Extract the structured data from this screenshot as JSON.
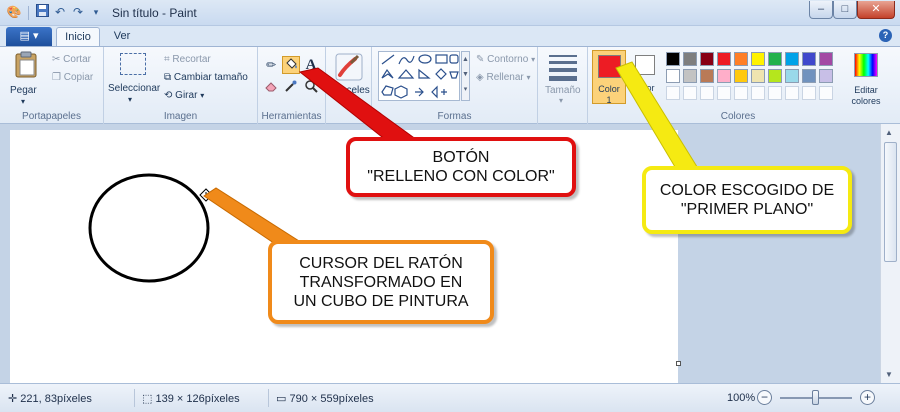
{
  "titlebar": {
    "title": "Sin título - Paint",
    "minimize": "–",
    "maximize": "□",
    "close": "✕",
    "qa_icons": [
      "paint-app-icon",
      "save-icon",
      "undo-icon",
      "redo-icon",
      "customize-qa-icon"
    ]
  },
  "tabs": {
    "app_menu": "▤ ▾",
    "items": [
      "Inicio",
      "Ver"
    ],
    "active": "Inicio",
    "help": "?"
  },
  "ribbon": {
    "portapapeles": {
      "label": "Portapapeles",
      "paste": "Pegar",
      "cut": "Cortar",
      "copy": "Copiar"
    },
    "imagen": {
      "label": "Imagen",
      "select": "Seleccionar",
      "crop": "Recortar",
      "resize": "Cambiar tamaño",
      "rotate": "Girar"
    },
    "herramientas": {
      "label": "Herramientas",
      "text_tool": "A"
    },
    "pinceles": {
      "label": "Pinceles"
    },
    "formas": {
      "label": "Formas",
      "outline": "Contorno",
      "fill": "Rellenar"
    },
    "tamano": {
      "label": "Tamaño"
    },
    "colores": {
      "label": "Colores",
      "color1": "Color 1",
      "color2": "Color",
      "color1_value": "#ed1c24",
      "color2_value": "#ffffff",
      "edit_colors": "Editar colores",
      "palette_row1": [
        "#000000",
        "#7f7f7f",
        "#880015",
        "#ed1c24",
        "#ff7f27",
        "#fff200",
        "#22b14c",
        "#00a2e8",
        "#3f48cc",
        "#a349a4"
      ],
      "palette_row2": [
        "#ffffff",
        "#c3c3c3",
        "#b97a57",
        "#ffaec9",
        "#ffc90e",
        "#efe4b0",
        "#b5e61d",
        "#99d9ea",
        "#7092be",
        "#c8bfe7"
      ]
    }
  },
  "statusbar": {
    "cursor_pos": "221, 83píxeles",
    "selection_size": "139 × 126píxeles",
    "image_size": "790 × 559píxeles",
    "zoom": "100%",
    "zoom_out": "−",
    "zoom_in": "+"
  },
  "callouts": {
    "fill_button": "BOTÓN\n\"RELLENO CON COLOR\"",
    "foreground_color": "COLOR ESCOGIDO DE\n\"PRIMER PLANO\"",
    "cursor": "CURSOR DEL RATÓN\nTRANSFORMADO EN\nUN CUBO DE PINTURA"
  },
  "colors": {
    "callout_red": "#e01010",
    "callout_yellow": "#f5ea12",
    "callout_orange": "#f08a1a",
    "workspace_bg": "#c4d3e6"
  }
}
